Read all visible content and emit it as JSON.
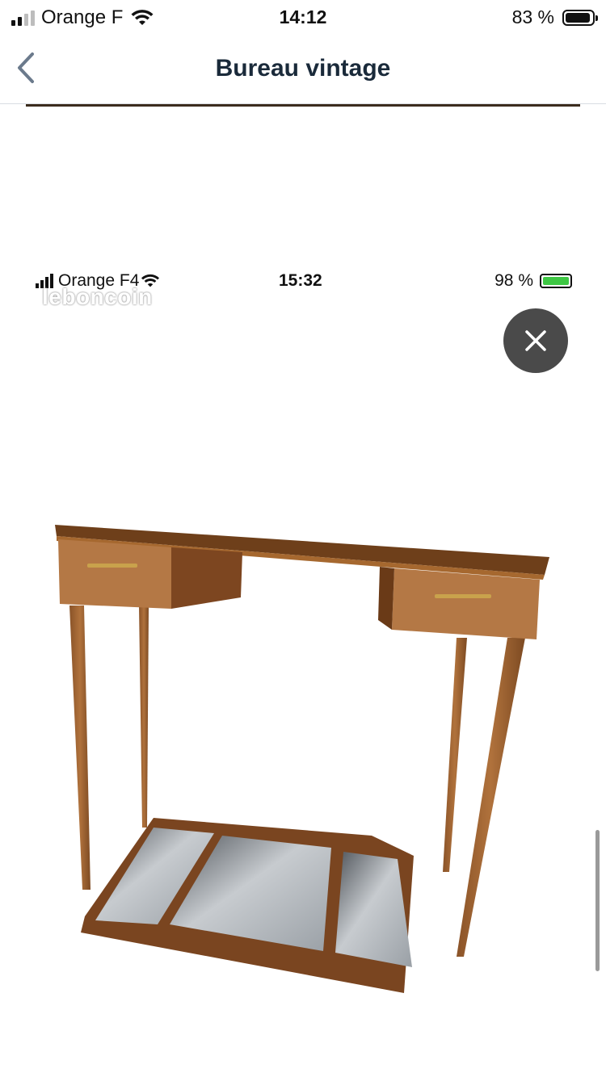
{
  "status_bar": {
    "carrier": "Orange F",
    "time": "14:12",
    "battery_percent": "83 %",
    "battery_level": 0.83
  },
  "nav": {
    "title": "Bureau vintage",
    "back_icon": "chevron-left-icon"
  },
  "image_viewer": {
    "embedded_status": {
      "carrier": "Orange F4",
      "time": "15:32",
      "battery_percent": "98 %",
      "battery_color": "#3ec744"
    },
    "watermark": "leboncoin",
    "close_icon": "close-icon",
    "photo_subject": "vintage wooden desk with two drawers and mirror"
  },
  "colors": {
    "nav_title": "#1a2a3a",
    "back_chevron": "#6b7a8c",
    "close_button_bg": "#4a4a4a",
    "wood": "#9a5e2e"
  }
}
